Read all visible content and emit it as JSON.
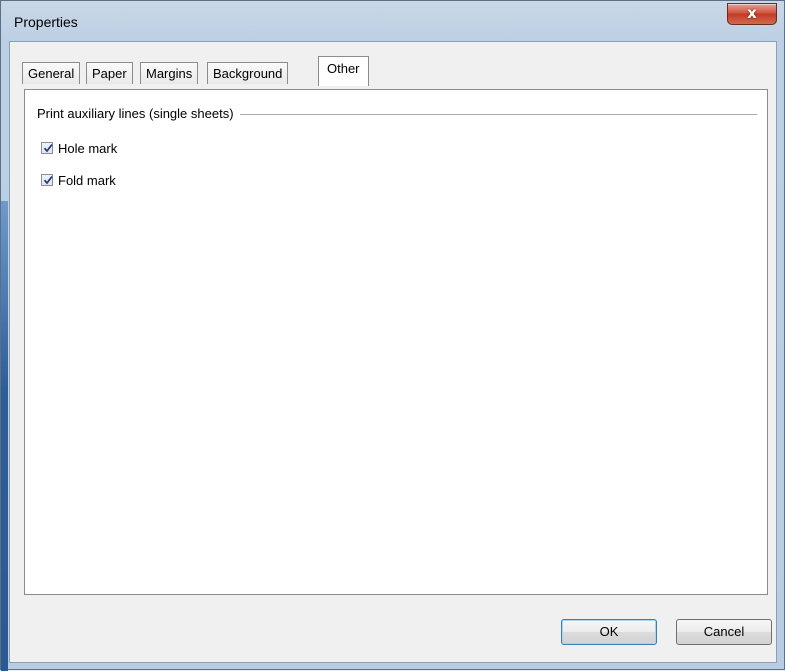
{
  "window": {
    "title": "Properties",
    "close_glyph": "x"
  },
  "tabs": [
    {
      "label": "General",
      "active": false
    },
    {
      "label": "Paper",
      "active": false
    },
    {
      "label": "Margins",
      "active": false
    },
    {
      "label": "Background",
      "active": false
    },
    {
      "label": "Other",
      "active": true
    }
  ],
  "group": {
    "title": "Print auxiliary lines (single sheets)",
    "options": [
      {
        "label": "Hole mark",
        "checked": true
      },
      {
        "label": "Fold mark",
        "checked": true
      }
    ]
  },
  "buttons": {
    "ok_label": "OK",
    "cancel_label": "Cancel"
  },
  "colors": {
    "title_bar": "#c0d3e7",
    "close_button": "#c9452e",
    "default_button_border": "#3c7fb1",
    "checkmark": "#2a3a82"
  }
}
